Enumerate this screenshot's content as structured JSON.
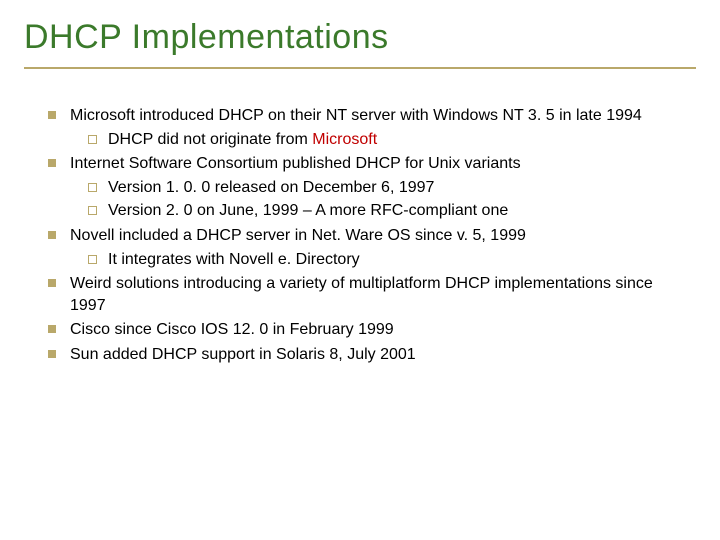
{
  "title": "DHCP Implementations",
  "items": [
    {
      "text": "Microsoft introduced DHCP on their NT server with Windows NT 3. 5 in late 1994",
      "sub": [
        {
          "prefix": "DHCP did not originate from ",
          "hl": "Microsoft"
        }
      ]
    },
    {
      "text": "Internet Software Consortium published DHCP for Unix variants",
      "sub": [
        {
          "prefix": "Version 1. 0. 0 released on December 6, 1997"
        },
        {
          "prefix": "Version 2. 0 on June, 1999 – A more RFC-compliant one"
        }
      ]
    },
    {
      "text": "Novell included a DHCP server in Net. Ware OS since v. 5, 1999",
      "sub": [
        {
          "prefix": "It integrates with Novell e. Directory"
        }
      ]
    },
    {
      "text": "Weird solutions introducing a variety of multiplatform DHCP implementations since 1997"
    },
    {
      "text": "Cisco since Cisco IOS 12. 0 in February 1999"
    },
    {
      "text": "Sun added DHCP support in Solaris 8, July 2001"
    }
  ]
}
